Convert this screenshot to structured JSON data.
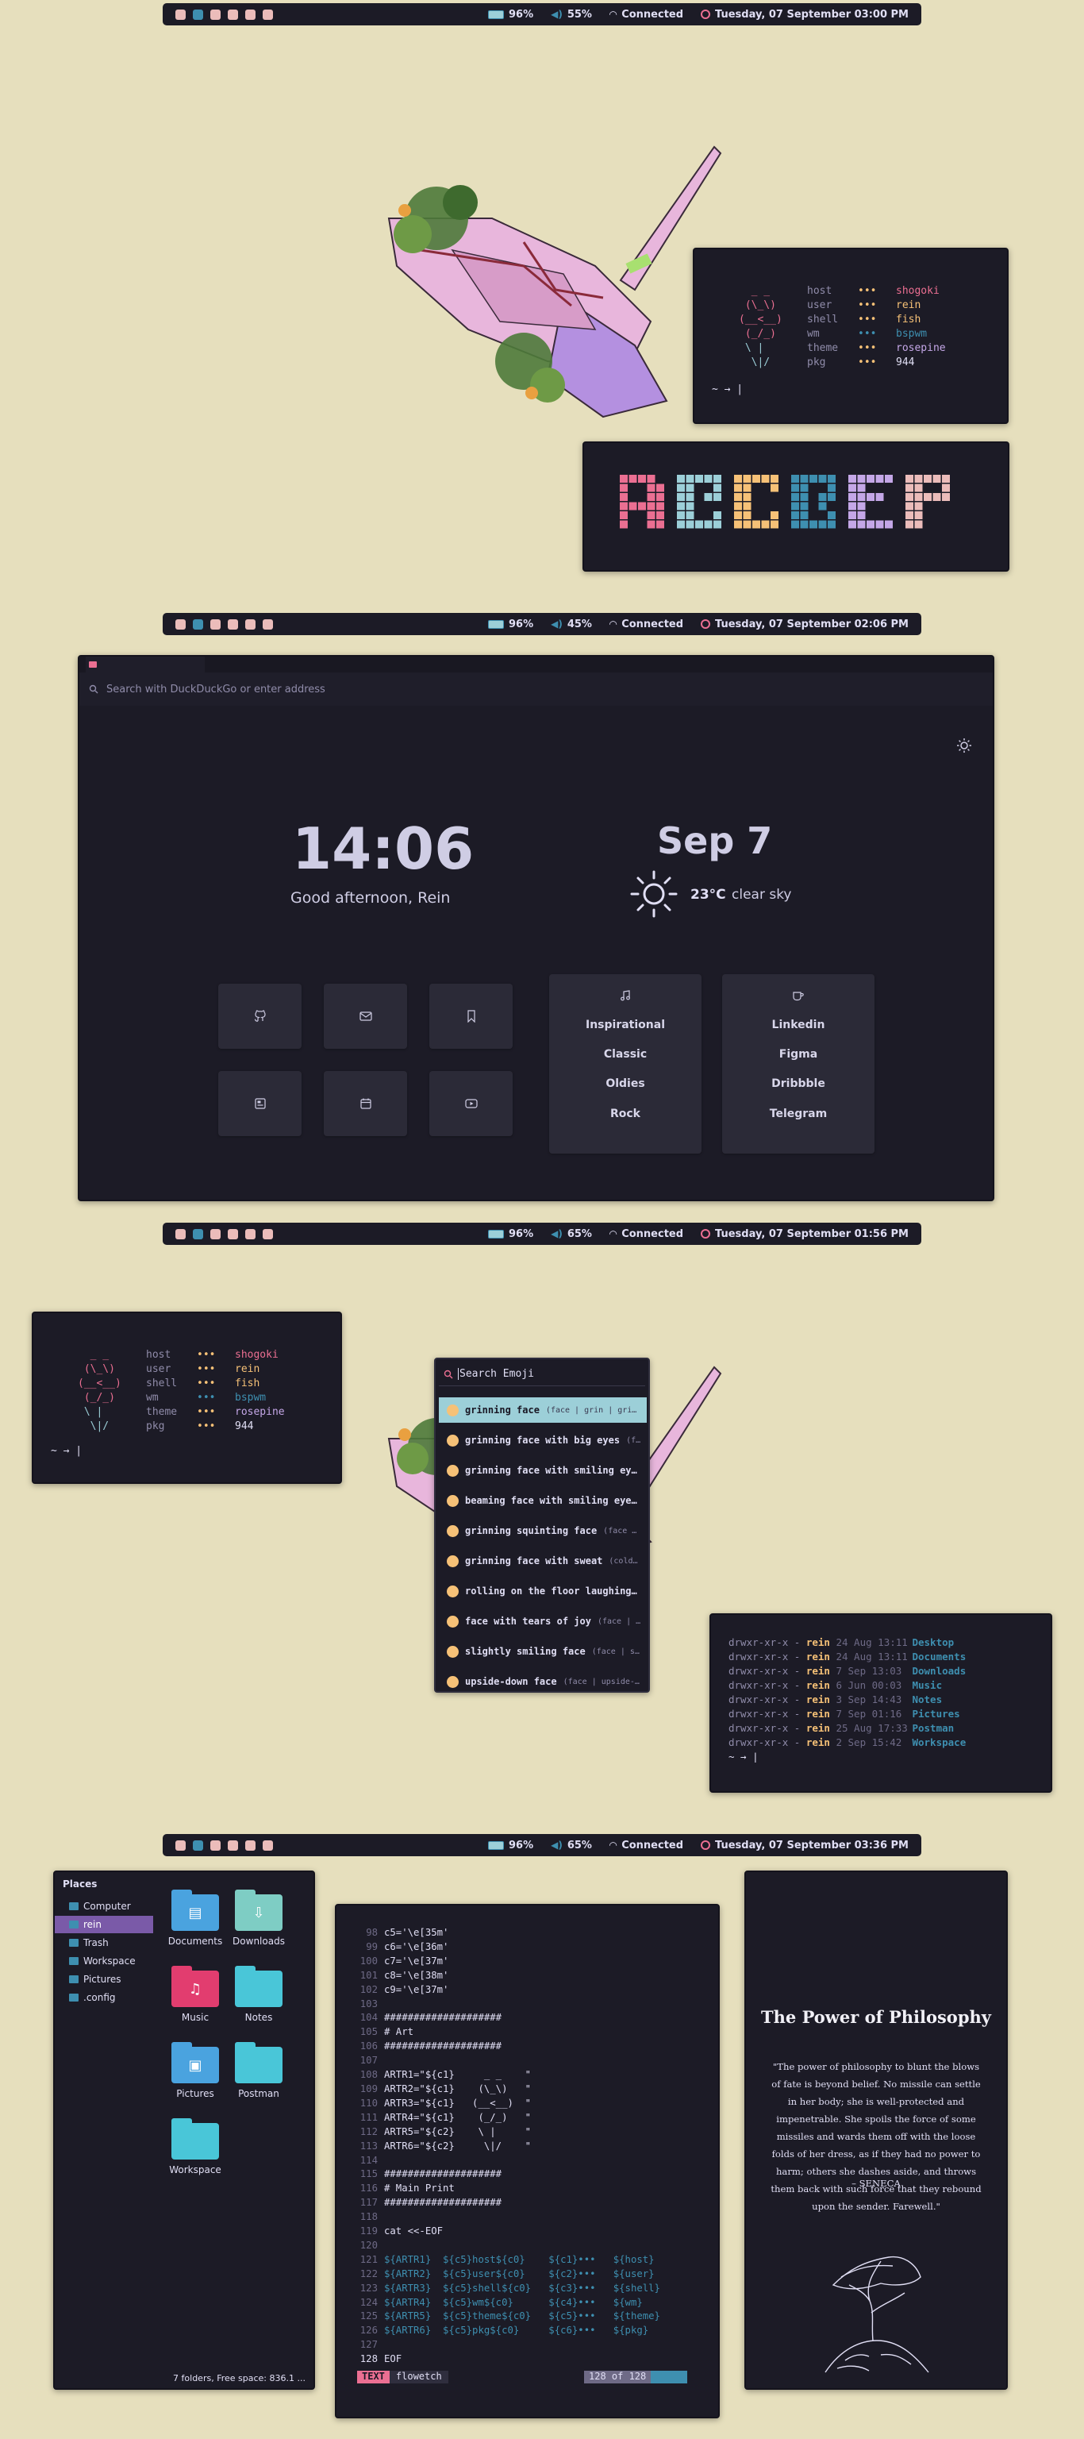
{
  "status_bars": [
    {
      "battery": "96%",
      "volume": "55%",
      "network": "Connected",
      "datetime": "Tuesday, 07 September 03:00 PM"
    },
    {
      "battery": "96%",
      "volume": "45%",
      "network": "Connected",
      "datetime": "Tuesday, 07 September 02:06 PM"
    },
    {
      "battery": "96%",
      "volume": "65%",
      "network": "Connected",
      "datetime": "Tuesday, 07 September 01:56 PM"
    },
    {
      "battery": "96%",
      "volume": "65%",
      "network": "Connected",
      "datetime": "Tuesday, 07 September 03:36 PM"
    }
  ],
  "fetch": {
    "art": [
      "  _ _",
      " (\\_\\)",
      "(__<__)",
      " (_/_)",
      " \\ |",
      "  \\|/"
    ],
    "rows": [
      {
        "key": "host",
        "dots": "•••",
        "value": "shogoki"
      },
      {
        "key": "user",
        "dots": "•••",
        "value": "rein"
      },
      {
        "key": "shell",
        "dots": "•••",
        "value": "fish"
      },
      {
        "key": "wm",
        "dots": "•••",
        "value": "bspwm"
      },
      {
        "key": "theme",
        "dots": "•••",
        "value": "rosepine"
      },
      {
        "key": "pkg",
        "dots": "•••",
        "value": "944"
      }
    ],
    "prompt": "~ → |"
  },
  "colorblocks": {
    "colors": [
      "#eb6f92",
      "#9ccfd8",
      "#f6c177",
      "#3e8fb0",
      "#c4a7e7",
      "#ebbcba"
    ]
  },
  "browser": {
    "address_placeholder": "Search with DuckDuckGo or enter address",
    "time": "14:06",
    "greeting": "Good afternoon, Rein",
    "date": "Sep 7",
    "temperature": "23°C",
    "weather": "clear sky",
    "music_list": [
      "Inspirational",
      "Classic",
      "Oldies",
      "Rock"
    ],
    "work_list": [
      "Linkedin",
      "Figma",
      "Dribbble",
      "Telegram"
    ],
    "tiles": [
      "github-icon",
      "mail-icon",
      "bookmark-icon",
      "news-icon",
      "calendar-icon",
      "youtube-icon"
    ]
  },
  "emoji": {
    "placeholder": "Search Emoji",
    "items": [
      {
        "name": "grinning face",
        "tags": "(face | grin | gri…"
      },
      {
        "name": "grinning face with big eyes",
        "tags": "(f…"
      },
      {
        "name": "grinning face with smiling ey…",
        "tags": ""
      },
      {
        "name": "beaming face with smiling eye…",
        "tags": ""
      },
      {
        "name": "grinning squinting face",
        "tags": "(face …"
      },
      {
        "name": "grinning face with sweat",
        "tags": "(cold…"
      },
      {
        "name": "rolling on the floor laughing…",
        "tags": ""
      },
      {
        "name": "face with tears of joy",
        "tags": "(face | …"
      },
      {
        "name": "slightly smiling face",
        "tags": "(face | s…"
      },
      {
        "name": "upside-down face",
        "tags": "(face | upside-…"
      }
    ]
  },
  "ls": {
    "rows": [
      {
        "perm": "drwxr-xr-x",
        "user": "rein",
        "date": "24 Aug 13:11",
        "name": "Desktop"
      },
      {
        "perm": "drwxr-xr-x",
        "user": "rein",
        "date": "24 Aug 13:11",
        "name": "Documents"
      },
      {
        "perm": "drwxr-xr-x",
        "user": "rein",
        "date": "7 Sep 13:03",
        "name": "Downloads"
      },
      {
        "perm": "drwxr-xr-x",
        "user": "rein",
        "date": "6 Jun 00:03",
        "name": "Music"
      },
      {
        "perm": "drwxr-xr-x",
        "user": "rein",
        "date": "3 Sep 14:43",
        "name": "Notes"
      },
      {
        "perm": "drwxr-xr-x",
        "user": "rein",
        "date": "7 Sep 01:16",
        "name": "Pictures"
      },
      {
        "perm": "drwxr-xr-x",
        "user": "rein",
        "date": "25 Aug 17:33",
        "name": "Postman"
      },
      {
        "perm": "drwxr-xr-x",
        "user": "rein",
        "date": "2 Sep 15:42",
        "name": "Workspace"
      }
    ],
    "prompt": "~ → |"
  },
  "filemanager": {
    "places_title": "Places",
    "places": [
      "Computer",
      "rein",
      "Trash",
      "Workspace",
      "Pictures",
      ".config"
    ],
    "folders": [
      {
        "name": "Documents",
        "color": "#4aa3df"
      },
      {
        "name": "Downloads",
        "color": "#7ecdc4"
      },
      {
        "name": "Music",
        "color": "#e23d6f"
      },
      {
        "name": "Notes",
        "color": "#49c6d8"
      },
      {
        "name": "Pictures",
        "color": "#4aa3df"
      },
      {
        "name": "Postman",
        "color": "#49c6d8"
      },
      {
        "name": "Workspace",
        "color": "#49c6d8"
      }
    ],
    "status": "7 folders, Free space: 836.1 ..."
  },
  "editor": {
    "lines": [
      {
        "n": "98",
        "t": "c5='\\e[35m'"
      },
      {
        "n": "99",
        "t": "c6='\\e[36m'"
      },
      {
        "n": "100",
        "t": "c7='\\e[37m'"
      },
      {
        "n": "101",
        "t": "c8='\\e[38m'"
      },
      {
        "n": "102",
        "t": "c9='\\e[37m'"
      },
      {
        "n": "103",
        "t": ""
      },
      {
        "n": "104",
        "t": "####################"
      },
      {
        "n": "105",
        "t": "# Art"
      },
      {
        "n": "106",
        "t": "####################"
      },
      {
        "n": "107",
        "t": ""
      },
      {
        "n": "108",
        "t": "ARTR1=\"${c1}     _ _    \""
      },
      {
        "n": "109",
        "t": "ARTR2=\"${c1}    (\\_\\)   \""
      },
      {
        "n": "110",
        "t": "ARTR3=\"${c1}   (__<__)  \""
      },
      {
        "n": "111",
        "t": "ARTR4=\"${c1}    (_/_)   \""
      },
      {
        "n": "112",
        "t": "ARTR5=\"${c2}    \\ |     \""
      },
      {
        "n": "113",
        "t": "ARTR6=\"${c2}     \\|/    \""
      },
      {
        "n": "114",
        "t": ""
      },
      {
        "n": "115",
        "t": "####################"
      },
      {
        "n": "116",
        "t": "# Main Print"
      },
      {
        "n": "117",
        "t": "####################"
      },
      {
        "n": "118",
        "t": ""
      },
      {
        "n": "119",
        "t": "cat <<-EOF"
      },
      {
        "n": "120",
        "t": ""
      },
      {
        "n": "121",
        "t": "${ARTR1}  ${c5}host${c0}    ${c1}•••   ${host}"
      },
      {
        "n": "122",
        "t": "${ARTR2}  ${c5}user${c0}    ${c2}•••   ${user}"
      },
      {
        "n": "123",
        "t": "${ARTR3}  ${c5}shell${c0}   ${c3}•••   ${shell}"
      },
      {
        "n": "124",
        "t": "${ARTR4}  ${c5}wm${c0}      ${c4}•••   ${wm}"
      },
      {
        "n": "125",
        "t": "${ARTR5}  ${c5}theme${c0}   ${c5}•••   ${theme}"
      },
      {
        "n": "126",
        "t": "${ARTR6}  ${c5}pkg${c0}     ${c6}•••   ${pkg}"
      },
      {
        "n": "127",
        "t": ""
      },
      {
        "n": "128",
        "t": "EOF"
      }
    ],
    "mode": "TEXT",
    "filename": "flowetch",
    "position": "128 of 128"
  },
  "philosophy": {
    "title": "The Power of Philosophy",
    "quote": "\"The power of philosophy to blunt the blows of fate is beyond belief. No missile can settle in her body; she is well-protected and impenetrable. She spoils the force of some missiles and wards them off with the loose folds of her dress, as if they had no power to harm; others she dashes aside, and throws them back with such force that they rebound upon the sender. Farewell.\"",
    "author": "– SENECA"
  }
}
